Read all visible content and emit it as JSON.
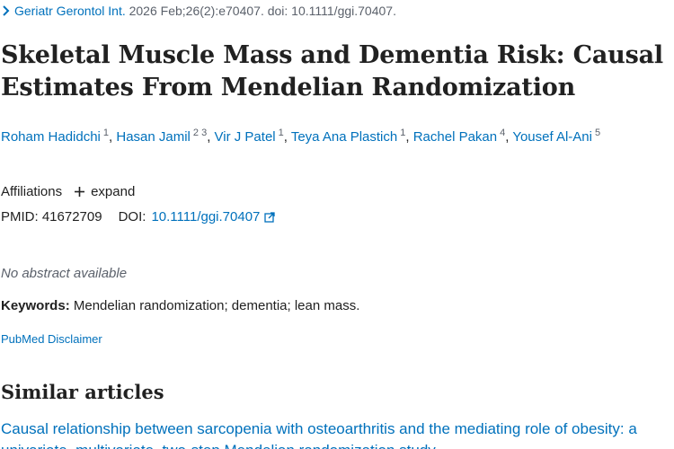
{
  "citation": {
    "journal": "Geriatr Gerontol Int.",
    "details": " 2026 Feb;26(2):e70407. doi: 10.1111/ggi.70407."
  },
  "article": {
    "title": "Skeletal Muscle Mass and Dementia Risk: Causal Estimates From Mendelian Randomization"
  },
  "authors": [
    {
      "name": "Roham Hadidchi",
      "aff": "1",
      "sep": ", "
    },
    {
      "name": "Hasan Jamil",
      "aff": "2 3",
      "sep": ", "
    },
    {
      "name": "Vir J Patel",
      "aff": "1",
      "sep": ", "
    },
    {
      "name": "Teya Ana Plastich",
      "aff": "1",
      "sep": ", "
    },
    {
      "name": "Rachel Pakan",
      "aff": "4",
      "sep": ", "
    },
    {
      "name": "Yousef Al-Ani",
      "aff": "5",
      "sep": ""
    }
  ],
  "affiliations": {
    "label": "Affiliations",
    "expand_label": "expand"
  },
  "ids": {
    "pmid_label": "PMID:",
    "pmid": "41672709",
    "doi_label": "DOI:",
    "doi": "10.1111/ggi.70407"
  },
  "abstract": {
    "none_text": "No abstract available"
  },
  "keywords": {
    "label": "Keywords:",
    "text": "Mendelian randomization; dementia; lean mass."
  },
  "disclaimer": {
    "label": "PubMed Disclaimer"
  },
  "similar": {
    "heading": "Similar articles",
    "first_item": "Causal relationship between sarcopenia with osteoarthritis and the mediating role of obesity: a univariate, multivariate, two-step Mendelian randomization study."
  },
  "colors": {
    "link": "#0071bc",
    "text": "#212121",
    "muted": "#5b616b"
  },
  "icons": {
    "citation": "chevron-right-icon",
    "expand": "plus-icon",
    "doi": "external-link-icon"
  }
}
